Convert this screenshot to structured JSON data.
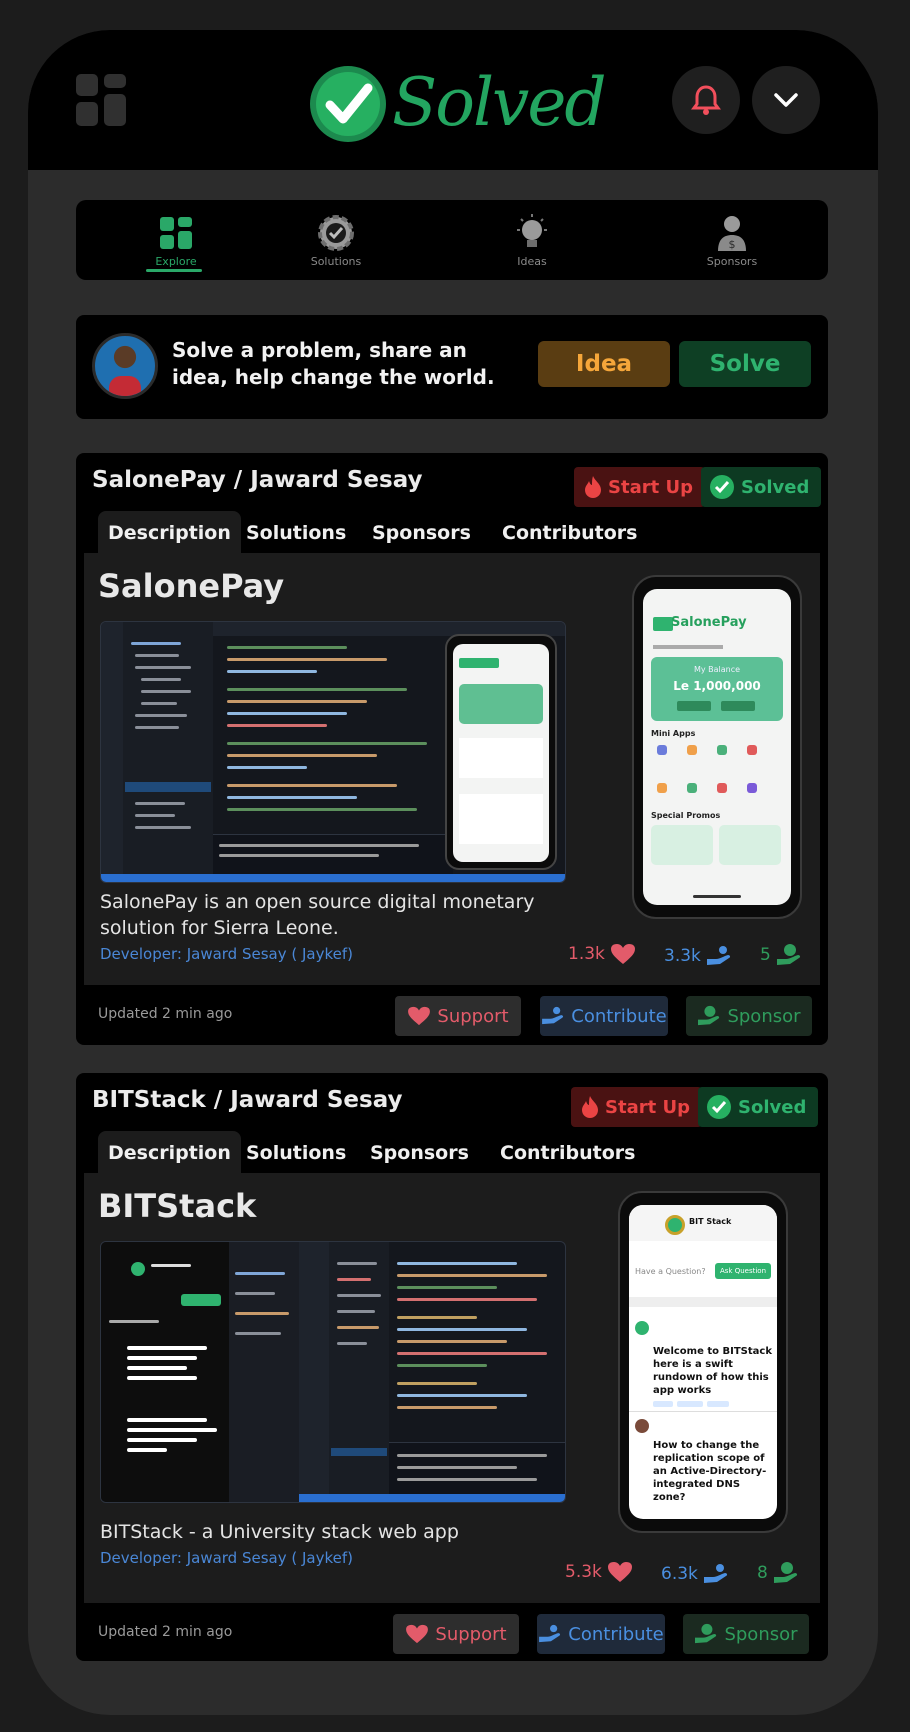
{
  "app": {
    "logo_text": "Solved"
  },
  "nav": {
    "items": [
      {
        "label": "Explore",
        "icon": "grid-icon",
        "active": true
      },
      {
        "label": "Solutions",
        "icon": "gear-check-icon"
      },
      {
        "label": "Ideas",
        "icon": "lightbulb-icon"
      },
      {
        "label": "Sponsors",
        "icon": "sponsor-icon"
      }
    ]
  },
  "promo": {
    "text": "Solve a problem, share an idea, help change the world.",
    "idea_label": "Idea",
    "solve_label": "Solve"
  },
  "cards": [
    {
      "title": "SalonePay / Jaward Sesay",
      "badge_startup": "Start Up",
      "badge_solved": "Solved",
      "tabs": [
        "Description",
        "Solutions",
        "Sponsors",
        "Contributors"
      ],
      "project_name": "SalonePay",
      "description": "SalonePay is an open source digital monetary solution for Sierra Leone.",
      "developer": "Developer: Jaward Sesay ( Jaykef)",
      "stats": {
        "support": "1.3k",
        "contribute": "3.3k",
        "sponsor": "5"
      },
      "updated": "Updated  2 min ago",
      "actions": {
        "support": "Support",
        "contribute": "Contribute",
        "sponsor": "Sponsor"
      },
      "mock_app": {
        "name": "SalonePay",
        "balance_label": "My Balance",
        "balance": "Le 1,000,000",
        "mini_apps": "Mini Apps",
        "promos": "Special Promos"
      }
    },
    {
      "title": "BITStack  / Jaward Sesay",
      "badge_startup": "Start Up",
      "badge_solved": "Solved",
      "tabs": [
        "Description",
        "Solutions",
        "Sponsors",
        "Contributors"
      ],
      "project_name": "BITStack",
      "description": "BITStack - a University stack web app",
      "developer": "Developer: Jaward Sesay ( Jaykef)",
      "stats": {
        "support": "5.3k",
        "contribute": "6.3k",
        "sponsor": "8"
      },
      "updated": "Updated  2 min ago",
      "actions": {
        "support": "Support",
        "contribute": "Contribute",
        "sponsor": "Sponsor"
      },
      "mock_app": {
        "name": "BIT Stack",
        "ask_placeholder": "Have a Question?",
        "ask_button": "Ask Question",
        "q1": "Welcome to BITStack here is a swift rundown of how this app works",
        "q2": "How to change the replication scope of an Active-Directory-integrated DNS zone?"
      }
    }
  ],
  "colors": {
    "brand": "#23a560",
    "startup": "#ea4444",
    "support": "#e35b6a",
    "contribute": "#4a8fe0",
    "sponsor": "#2f9c5c",
    "idea": "#f5a63a"
  }
}
